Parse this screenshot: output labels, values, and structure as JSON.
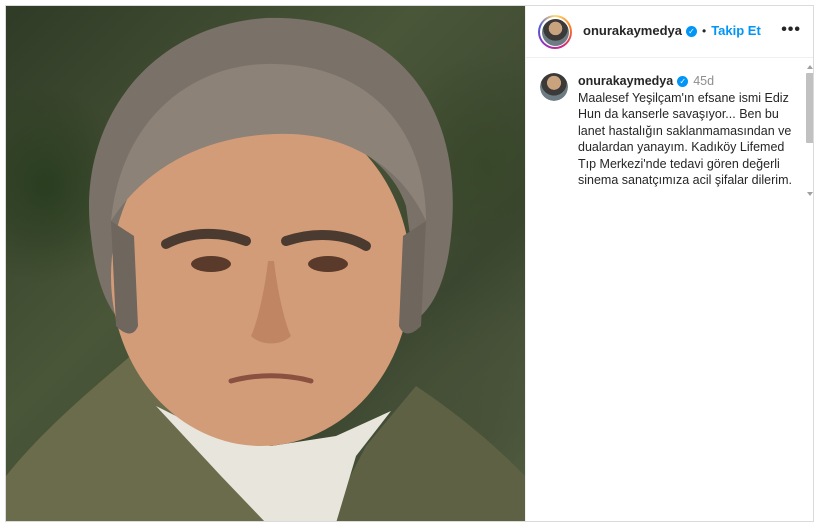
{
  "post": {
    "image_alt_icon": "portrait-photo",
    "header": {
      "username": "onurakaymedya",
      "verified_mark": "✓",
      "separator": "•",
      "follow_label": "Takip Et",
      "more_label": "•••"
    },
    "caption": {
      "username": "onurakaymedya",
      "verified_mark": "✓",
      "age": "45d",
      "text": "Maalesef Yeşilçam'ın efsane ismi Ediz Hun da kanserle savaşıyor... Ben bu lanet hastalığın saklanmamasından ve dualardan yanayım. Kadıköy Lifemed Tıp Merkezi'nde tedavi gören değerli sinema sanatçımıza acil şifalar dilerim."
    }
  },
  "colors": {
    "link_blue": "#0095f6",
    "text": "#262626",
    "muted": "#8e8e8e",
    "border": "#dbdbdb"
  }
}
